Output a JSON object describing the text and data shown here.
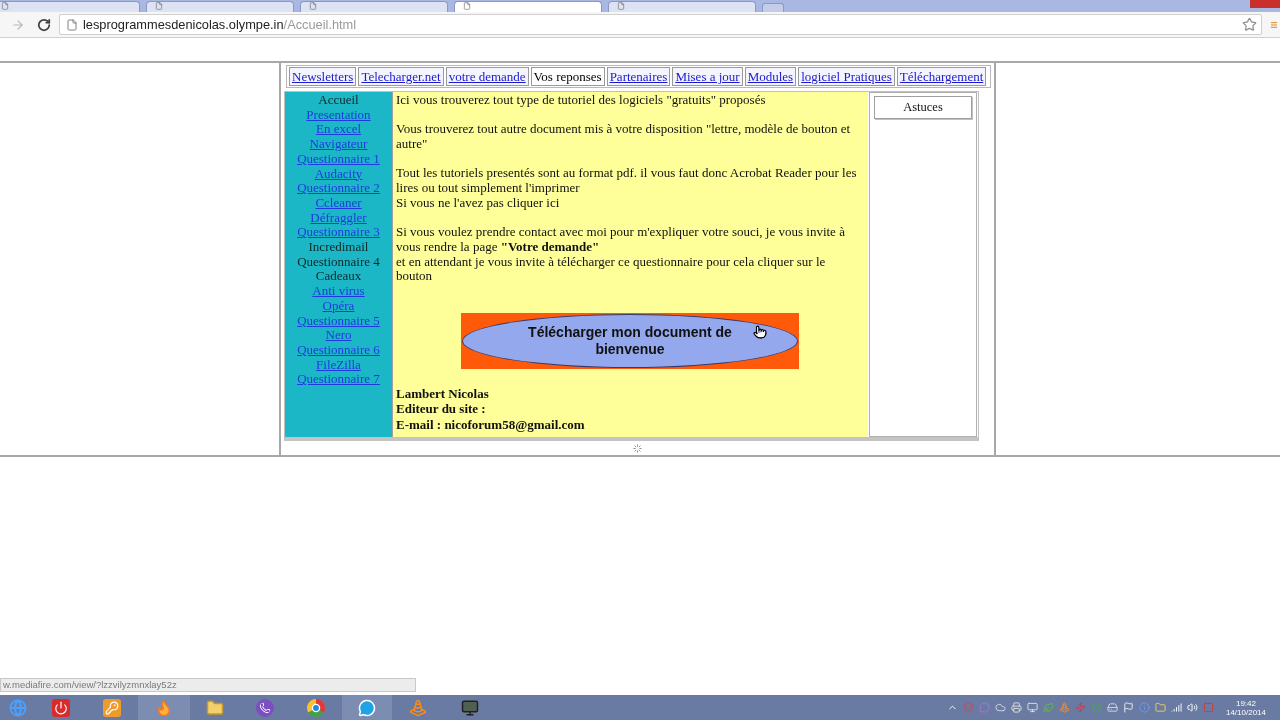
{
  "browser": {
    "tabs": [
      {
        "selected": false
      },
      {
        "selected": false
      },
      {
        "selected": false
      },
      {
        "selected": true
      },
      {
        "selected": false
      }
    ],
    "address": {
      "domain": "lesprogrammesdenicolas.olympe.in",
      "path": "/Accueil.html"
    }
  },
  "nav_tabs": [
    {
      "label": "Newsletters",
      "selected": false
    },
    {
      "label": "Telecharger.net",
      "selected": false
    },
    {
      "label": "votre demande",
      "selected": false
    },
    {
      "label": "Vos reponses",
      "selected": true
    },
    {
      "label": "Partenaires",
      "selected": false
    },
    {
      "label": "Mises a jour",
      "selected": false
    },
    {
      "label": "Modules",
      "selected": false
    },
    {
      "label": "logiciel Pratiques",
      "selected": false
    },
    {
      "label": "Téléchargement",
      "selected": false
    }
  ],
  "sidebar": {
    "items": [
      {
        "label": "Accueil",
        "link": false
      },
      {
        "label": "Presentation",
        "link": true
      },
      {
        "label": "En excel",
        "link": true
      },
      {
        "label": "Navigateur",
        "link": true
      },
      {
        "label": "Questionnaire 1",
        "link": true
      },
      {
        "label": "Audacity",
        "link": true
      },
      {
        "label": "Questionnaire 2",
        "link": true
      },
      {
        "label": "Ccleaner",
        "link": true
      },
      {
        "label": "Défraggler",
        "link": true
      },
      {
        "label": "Questionnaire 3",
        "link": true
      },
      {
        "label": "Incredimail",
        "link": false
      },
      {
        "label": "Questionnaire 4",
        "link": false
      },
      {
        "label": "Cadeaux",
        "link": false
      },
      {
        "label": "Anti virus",
        "link": true
      },
      {
        "label": "Opéra",
        "link": true
      },
      {
        "label": "Questionnaire 5",
        "link": true
      },
      {
        "label": "Nero",
        "link": true
      },
      {
        "label": "Questionnaire 6",
        "link": true
      },
      {
        "label": "FileZilla",
        "link": true
      },
      {
        "label": "Questionnaire 7",
        "link": true
      }
    ]
  },
  "content": {
    "paragraphs": [
      [
        "Ici vous trouverez tout type de tutoriel des logiciels \"gratuits\" proposés"
      ],
      [
        "Vous trouverez tout autre document mis à votre disposition \"lettre, modèle de bouton et autre\""
      ],
      [
        "Tout les tutoriels presentés sont au format pdf. il vous faut donc Acrobat Reader pour les lires ou tout simplement l'imprimer",
        "Si vous ne l'avez pas cliquer ici"
      ],
      [
        "Si vous voulez prendre contact avec moi pour m'expliquer votre souci, je vous invite à vous rendre  la page **\"Votre demande\"**",
        "et en attendant je vous invite à télécharger ce questionnaire pour cela cliquer sur le bouton"
      ]
    ],
    "download_button": "Télécharger mon document de bienvenue",
    "author": "Lambert Nicolas",
    "publisher": "Editeur du site :",
    "email": "E-mail : nicoforum58@gmail.com"
  },
  "right_panel": {
    "button": "Astuces"
  },
  "status_url": "w.mediafire.com/view/?lzzvilyzmnxlay52z",
  "taskbar": {
    "time": "19:42",
    "date": "14/10/2014"
  }
}
